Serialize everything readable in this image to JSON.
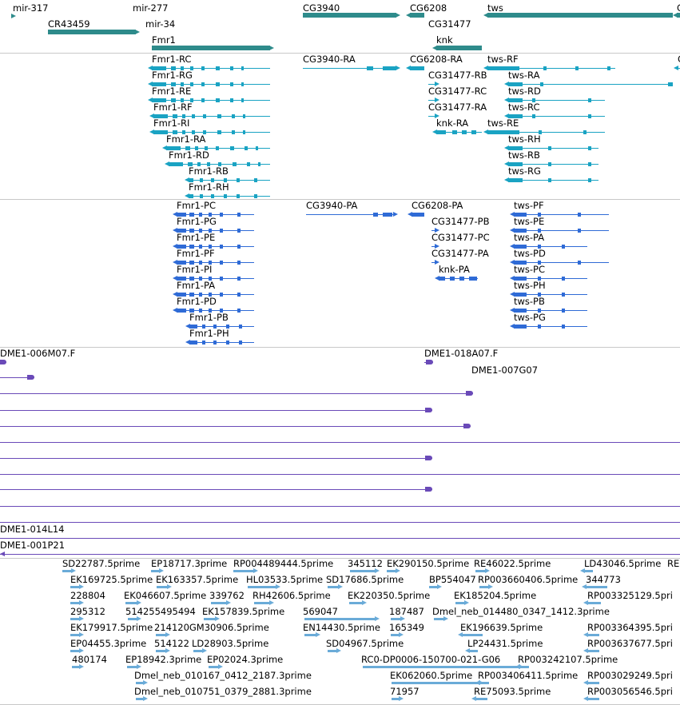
{
  "colors": {
    "gene": "#2e8b8b",
    "transcript": "#1aa3c3",
    "protein": "#2f6bd6",
    "clone": "#6a4ab8",
    "est": "#6aabd8",
    "separator": "#c8c8c8"
  },
  "tracks": {
    "genes": [
      {
        "label": "mir-317",
        "strand": "+"
      },
      {
        "label": "mir-277",
        "strand": "+"
      },
      {
        "label": "CR43459",
        "strand": "+"
      },
      {
        "label": "mir-34",
        "strand": "+"
      },
      {
        "label": "Fmr1",
        "strand": "+"
      },
      {
        "label": "CG3940",
        "strand": "+"
      },
      {
        "label": "CG6208",
        "strand": "-"
      },
      {
        "label": "CG31477",
        "strand": "+"
      },
      {
        "label": "knk",
        "strand": "-"
      },
      {
        "label": "tws",
        "strand": "-"
      },
      {
        "label": "C",
        "strand": "-"
      }
    ],
    "transcripts": [
      {
        "label": "Fmr1-RC"
      },
      {
        "label": "Fmr1-RG"
      },
      {
        "label": "Fmr1-RE"
      },
      {
        "label": "Fmr1-RF"
      },
      {
        "label": "Fmr1-RI"
      },
      {
        "label": "Fmr1-RA"
      },
      {
        "label": "Fmr1-RD"
      },
      {
        "label": "Fmr1-RB"
      },
      {
        "label": "Fmr1-RH"
      },
      {
        "label": "CG3940-RA"
      },
      {
        "label": "CG6208-RA"
      },
      {
        "label": "CG31477-RB"
      },
      {
        "label": "CG31477-RC"
      },
      {
        "label": "CG31477-RA"
      },
      {
        "label": "knk-RA"
      },
      {
        "label": "tws-RF"
      },
      {
        "label": "tws-RA"
      },
      {
        "label": "tws-RD"
      },
      {
        "label": "tws-RC"
      },
      {
        "label": "tws-RE"
      },
      {
        "label": "tws-RH"
      },
      {
        "label": "tws-RB"
      },
      {
        "label": "tws-RG"
      },
      {
        "label": "C"
      }
    ],
    "proteins": [
      {
        "label": "Fmr1-PC"
      },
      {
        "label": "Fmr1-PG"
      },
      {
        "label": "Fmr1-PE"
      },
      {
        "label": "Fmr1-PF"
      },
      {
        "label": "Fmr1-PI"
      },
      {
        "label": "Fmr1-PA"
      },
      {
        "label": "Fmr1-PD"
      },
      {
        "label": "Fmr1-PB"
      },
      {
        "label": "Fmr1-PH"
      },
      {
        "label": "CG3940-PA"
      },
      {
        "label": "CG6208-PA"
      },
      {
        "label": "CG31477-PB"
      },
      {
        "label": "CG31477-PC"
      },
      {
        "label": "CG31477-PA"
      },
      {
        "label": "knk-PA"
      },
      {
        "label": "tws-PF"
      },
      {
        "label": "tws-PE"
      },
      {
        "label": "tws-PA"
      },
      {
        "label": "tws-PD"
      },
      {
        "label": "tws-PC"
      },
      {
        "label": "tws-PH"
      },
      {
        "label": "tws-PB"
      },
      {
        "label": "tws-PG"
      }
    ],
    "clones": [
      {
        "label": "DME1-006M07.F"
      },
      {
        "label": "DME1-018A07.F"
      },
      {
        "label": "DME1-007G07"
      },
      {
        "label": "DME1-014L14"
      },
      {
        "label": "DME1-001P21"
      }
    ],
    "ests": [
      {
        "label": "SD22787.5prime"
      },
      {
        "label": "EP18717.3prime"
      },
      {
        "label": "RP004489444.5prime"
      },
      {
        "label": "345112"
      },
      {
        "label": "EK290150.5prime"
      },
      {
        "label": "RE46022.5prime"
      },
      {
        "label": "LD43046.5prime"
      },
      {
        "label": "RE"
      },
      {
        "label": "EK169725.5prime"
      },
      {
        "label": "EK163357.5prime"
      },
      {
        "label": "HL03533.5prime"
      },
      {
        "label": "SD17686.5prime"
      },
      {
        "label": "BP554047"
      },
      {
        "label": "RP003660406.5prime"
      },
      {
        "label": "344773"
      },
      {
        "label": "228804"
      },
      {
        "label": "EK046607.5prime"
      },
      {
        "label": "339762"
      },
      {
        "label": "RH42606.5prime"
      },
      {
        "label": "EK220350.5prime"
      },
      {
        "label": "EK185204.5prime"
      },
      {
        "label": "RP003325129.5pri"
      },
      {
        "label": "295312"
      },
      {
        "label": "514255495494"
      },
      {
        "label": "EK157839.5prime"
      },
      {
        "label": "569047"
      },
      {
        "label": "187487"
      },
      {
        "label": "Dmel_neb_014480_0347_1412.3prime"
      },
      {
        "label": "EK179917.5prime"
      },
      {
        "label": "214120GM30906.5prime"
      },
      {
        "label": "EN14430.5prime"
      },
      {
        "label": "165349"
      },
      {
        "label": "EK196639.5prime"
      },
      {
        "label": "RP003364395.5pri"
      },
      {
        "label": "EP04455.3prime"
      },
      {
        "label": "514122"
      },
      {
        "label": "LD28903.5prime"
      },
      {
        "label": "SD04967.5prime"
      },
      {
        "label": "LP24431.5prime"
      },
      {
        "label": "RP003637677.5pri"
      },
      {
        "label": "480174"
      },
      {
        "label": "EP18942.3prime"
      },
      {
        "label": "EP02024.3prime"
      },
      {
        "label": "RC0-DP0006-150700-021-G06"
      },
      {
        "label": "RP003242107.5prime"
      },
      {
        "label": "Dmel_neb_010167_0412_2187.3prime"
      },
      {
        "label": "EK062060.5prime"
      },
      {
        "label": "RP003406411.5prime"
      },
      {
        "label": "RP003029249.5pri"
      },
      {
        "label": "Dmel_neb_010751_0379_2881.3prime"
      },
      {
        "label": "71957"
      },
      {
        "label": "RE75093.5prime"
      },
      {
        "label": "RP003056546.5pri"
      }
    ]
  }
}
